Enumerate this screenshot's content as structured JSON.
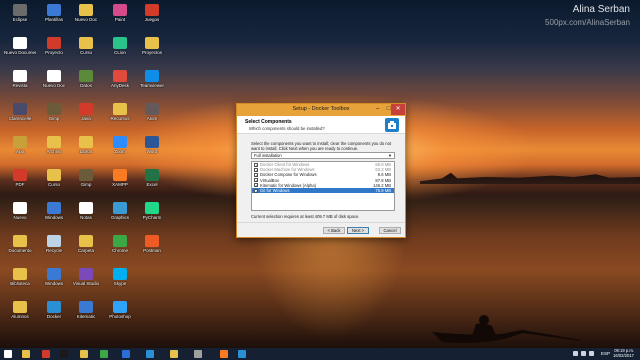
{
  "watermark": {
    "name": "Alina Serban",
    "url": "500px.com/AlinaSerban"
  },
  "desktop_icons": [
    {
      "label": "Eclipse",
      "icon": "app-icon",
      "color": "#6b6b6b"
    },
    {
      "label": "Nuevo Documento",
      "icon": "document-icon",
      "color": "#ffffff"
    },
    {
      "label": "Revista",
      "icon": "document-icon",
      "color": "#ffffff"
    },
    {
      "label": "Clarencelle",
      "icon": "app-icon",
      "color": "#4a4a6a"
    },
    {
      "label": "App",
      "icon": "app-icon",
      "color": "#c8a03a"
    },
    {
      "label": "PDF",
      "icon": "pdf-icon",
      "color": "#d23a2a"
    },
    {
      "label": "Nuevo",
      "icon": "document-icon",
      "color": "#ffffff"
    },
    {
      "label": "Documento",
      "icon": "folder-icon",
      "color": "#e8c14a"
    },
    {
      "label": "Biblioteca",
      "icon": "folder-icon",
      "color": "#e8c14a"
    },
    {
      "label": "Alumnos",
      "icon": "folder-icon",
      "color": "#e8c14a"
    },
    {
      "label": "Plantillas",
      "icon": "app-icon",
      "color": "#3a7ad4"
    },
    {
      "label": "Proyecto",
      "icon": "app-icon",
      "color": "#d23a2a"
    },
    {
      "label": "Nuevo Doc",
      "icon": "document-icon",
      "color": "#ffffff"
    },
    {
      "label": "Gimp",
      "icon": "app-icon",
      "color": "#6b5b3a"
    },
    {
      "label": "Archivo",
      "icon": "folder-icon",
      "color": "#e8c14a"
    },
    {
      "label": "Curso",
      "icon": "folder-icon",
      "color": "#e8c14a"
    },
    {
      "label": "Windows",
      "icon": "app-icon",
      "color": "#3a7ad4"
    },
    {
      "label": "Recycle",
      "icon": "recycle-icon",
      "color": "#bcd4e6"
    },
    {
      "label": "Windows",
      "icon": "app-icon",
      "color": "#3a7ad4"
    },
    {
      "label": "Docker",
      "icon": "app-icon",
      "color": "#2b8fd6"
    },
    {
      "label": "Nuevo Doc",
      "icon": "folder-icon",
      "color": "#e8c14a"
    },
    {
      "label": "Curso",
      "icon": "folder-icon",
      "color": "#e8c14a"
    },
    {
      "label": "Datos",
      "icon": "app-icon",
      "color": "#5a8a3a"
    },
    {
      "label": "Java",
      "icon": "app-icon",
      "color": "#d23a2a"
    },
    {
      "label": "Libros",
      "icon": "folder-icon",
      "color": "#e8c14a"
    },
    {
      "label": "Gimp",
      "icon": "app-icon",
      "color": "#6b5b3a"
    },
    {
      "label": "Notas",
      "icon": "document-icon",
      "color": "#ffffff"
    },
    {
      "label": "Carpeta",
      "icon": "folder-icon",
      "color": "#e8c14a"
    },
    {
      "label": "Visual Studio",
      "icon": "app-icon",
      "color": "#7a4ab8"
    },
    {
      "label": "Kitematic",
      "icon": "app-icon",
      "color": "#3a7ad4"
    },
    {
      "label": "Paint",
      "icon": "app-icon",
      "color": "#d44a8a"
    },
    {
      "label": "CLion",
      "icon": "app-icon",
      "color": "#2ac48a"
    },
    {
      "label": "AnyDesk",
      "icon": "app-icon",
      "color": "#e04a3a"
    },
    {
      "label": "Recursos",
      "icon": "folder-icon",
      "color": "#e8c14a"
    },
    {
      "label": "Zoom",
      "icon": "app-icon",
      "color": "#2d8cff"
    },
    {
      "label": "XAMPP",
      "icon": "app-icon",
      "color": "#fb7a24"
    },
    {
      "label": "Graphics",
      "icon": "app-icon",
      "color": "#3a9ad4"
    },
    {
      "label": "Chrome",
      "icon": "app-icon",
      "color": "#3aa845"
    },
    {
      "label": "Skype",
      "icon": "app-icon",
      "color": "#00aff0"
    },
    {
      "label": "Photoshop",
      "icon": "app-icon",
      "color": "#2fa3f7"
    },
    {
      "label": "Juegos",
      "icon": "app-icon",
      "color": "#d23a2a"
    },
    {
      "label": "Proyectos",
      "icon": "folder-icon",
      "color": "#e8c14a"
    },
    {
      "label": "Teamviewer",
      "icon": "app-icon",
      "color": "#0e8ee9"
    },
    {
      "label": "Atom",
      "icon": "app-icon",
      "color": "#66595c"
    },
    {
      "label": "Word",
      "icon": "app-icon",
      "color": "#2b5797"
    },
    {
      "label": "Excel",
      "icon": "app-icon",
      "color": "#217346"
    },
    {
      "label": "PyCharm",
      "icon": "app-icon",
      "color": "#21d789"
    },
    {
      "label": "Postman",
      "icon": "app-icon",
      "color": "#ef5b25"
    }
  ],
  "window": {
    "title": "Setup - Docker Toolbox",
    "header_title": "Select Components",
    "header_subtitle": "Which components should be installed?",
    "description": "Select the components you want to install; clear the components you do not want to install. Click Next when you are ready to continue.",
    "install_type": "Full installation",
    "components": [
      {
        "name": "Docker Client for Windows",
        "size": "65.8 MB",
        "checked": true,
        "disabled": true,
        "selected": false
      },
      {
        "name": "Docker Machine for Windows",
        "size": "63.3 MB",
        "checked": true,
        "disabled": true,
        "selected": false
      },
      {
        "name": "Docker Compose for Windows",
        "size": "8.6 MB",
        "checked": true,
        "disabled": false,
        "selected": false
      },
      {
        "name": "VirtualBox",
        "size": "87.8 MB",
        "checked": true,
        "disabled": false,
        "selected": false
      },
      {
        "name": "Kitematic for Windows (Alpha)",
        "size": "146.2 MB",
        "checked": true,
        "disabled": false,
        "selected": false
      },
      {
        "name": "Git for Windows",
        "size": "75.9 MB",
        "checked": true,
        "disabled": false,
        "selected": true
      }
    ],
    "space_required": "Current selection requires at least 409.7 MB of disk space.",
    "back_label": "< Back",
    "next_label": "Next >",
    "cancel_label": "Cancel",
    "accent": "#e8a23a",
    "close_color": "#c7413a"
  },
  "taskbar": {
    "language": "ESP",
    "time": "09:19 p.m.",
    "date": "16/02/2017",
    "items": [
      {
        "name": "start-icon",
        "color": "#ffffff"
      },
      {
        "name": "file-explorer-icon",
        "color": "#e8c14a"
      },
      {
        "name": "media-icon",
        "color": "#d23a2a"
      },
      {
        "name": "terminal-icon",
        "color": "#1a1a1a"
      },
      {
        "name": "calculator-icon",
        "color": "#e8c14a"
      },
      {
        "name": "chrome-icon",
        "color": "#3aa845"
      },
      {
        "name": "edge-icon",
        "color": "#2b6fd6"
      },
      {
        "name": "vscode-icon",
        "color": "#2b8fd6"
      },
      {
        "name": "folder-icon",
        "color": "#e8c14a"
      },
      {
        "name": "settings-icon",
        "color": "#a0a0a0"
      },
      {
        "name": "xampp-icon",
        "color": "#fb7a24"
      },
      {
        "name": "docker-setup-icon",
        "color": "#2b8fd6"
      }
    ]
  }
}
